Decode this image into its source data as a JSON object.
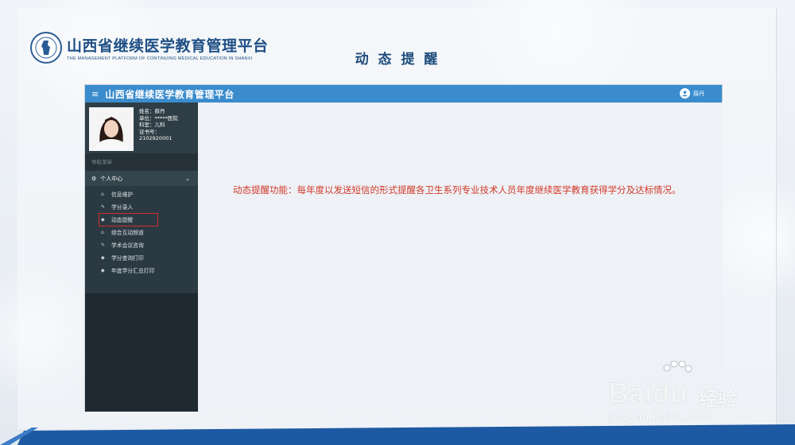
{
  "slide": {
    "logo_title": "山西省继续医学教育管理平台",
    "logo_subtitle": "THE MANAGEMENT PLATFORM OF CONTINUING MEDICAL EDUCATION IN SHANXI",
    "heading": "动 态 提 醒"
  },
  "app": {
    "title": "山西省继续医学教育管理平台",
    "user_name": "薛丹"
  },
  "profile": {
    "name_line": "姓名：薛丹",
    "unit_line": "单位：*****医院",
    "dept_line": "科室：儿科",
    "cert_label": "证书号：",
    "cert_number": "2102920001"
  },
  "nav": {
    "header": "导航菜单",
    "group_label": "个人中心",
    "items": [
      {
        "label": "信息维护",
        "icon": "home-icon"
      },
      {
        "label": "学分录入",
        "icon": "edit-icon"
      },
      {
        "label": "动态提醒",
        "icon": "tag-icon"
      },
      {
        "label": "综合互动频道",
        "icon": "home-icon"
      },
      {
        "label": "学术会议咨询",
        "icon": "edit-icon"
      },
      {
        "label": "学分查询打印",
        "icon": "tag-icon"
      },
      {
        "label": "年度学分汇总打印",
        "icon": "tag-icon"
      }
    ]
  },
  "content": {
    "description": "动态提醒功能：每年度以发送短信的形式提醒各卫生系列专业技术人员年度继续医学教育获得学分及达标情况。"
  },
  "watermark": {
    "brand": "Bai",
    "brand2": "du",
    "cn": "经验",
    "url": "jingyan.baidu.com"
  },
  "colors": {
    "topbar": "#3a8ccd",
    "sidebar": "#2b3a42",
    "highlight": "#d22d2d",
    "description_text": "#d23a2a"
  }
}
